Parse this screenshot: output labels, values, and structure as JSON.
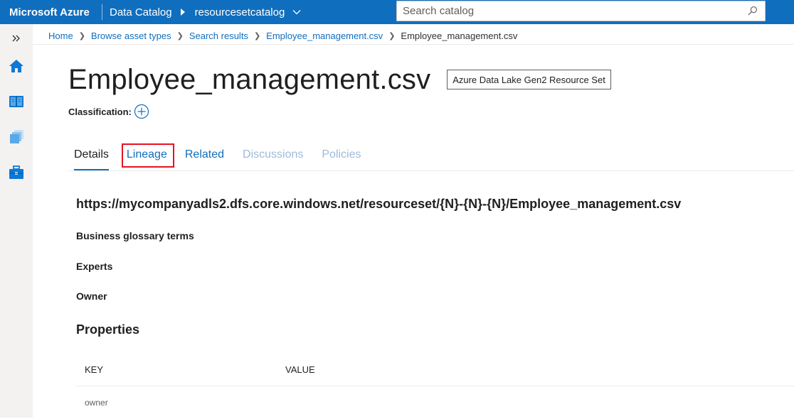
{
  "topbar": {
    "brand": "Microsoft Azure",
    "service": "Data Catalog",
    "catalog": "resourcesetcatalog",
    "search_placeholder": "Search catalog",
    "bg_color": "#106ebe"
  },
  "rail": {
    "items": [
      {
        "name": "expand-icon"
      },
      {
        "name": "home-icon"
      },
      {
        "name": "glossary-book-icon"
      },
      {
        "name": "collections-icon"
      },
      {
        "name": "management-toolbox-icon"
      }
    ]
  },
  "breadcrumb": {
    "items": [
      "Home",
      "Browse asset types",
      "Search results",
      "Employee_management.csv"
    ],
    "current": "Employee_management.csv"
  },
  "asset": {
    "title": "Employee_management.csv",
    "type_badge": "Azure Data Lake Gen2 Resource Set",
    "classification_label": "Classification:"
  },
  "tabs": [
    {
      "label": "Details",
      "state": "active"
    },
    {
      "label": "Lineage",
      "state": "link",
      "highlighted": true
    },
    {
      "label": "Related",
      "state": "link"
    },
    {
      "label": "Discussions",
      "state": "disabled"
    },
    {
      "label": "Policies",
      "state": "disabled"
    }
  ],
  "details": {
    "qualified_name": "https://mycompanyadls2.dfs.core.windows.net/resourceset/{N}-{N}-{N}/Employee_management.csv",
    "glossary_label": "Business glossary terms",
    "experts_label": "Experts",
    "owner_label": "Owner",
    "properties_heading": "Properties",
    "properties_columns": [
      "KEY",
      "VALUE"
    ],
    "properties_rows": [
      {
        "key": "owner",
        "value": ""
      }
    ]
  },
  "colors": {
    "accent": "#106ebe",
    "highlight_border": "#e81123",
    "disabled_tab": "#9fb9db"
  }
}
